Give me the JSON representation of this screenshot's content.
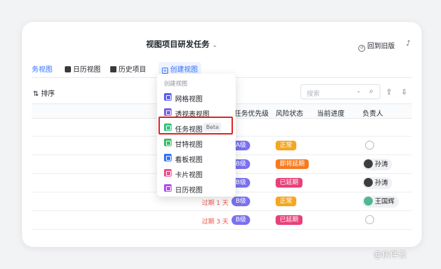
{
  "header": {
    "title": "视图项目研发任务",
    "title_chevron": "⌄",
    "back_label": "回到旧版"
  },
  "tabs": [
    {
      "label": "务视图",
      "active": true
    },
    {
      "label": "日历视图"
    },
    {
      "label": "历史项目"
    },
    {
      "label": "创建视图"
    }
  ],
  "toolbar": {
    "sort_label": "排序",
    "search_placeholder": "搜索"
  },
  "columns": [
    "任务优先级",
    "风险状态",
    "当前进度",
    "负责人"
  ],
  "rows": [
    {
      "overdue": "",
      "level": "A级",
      "risk": "正常",
      "risk_color": "#f5a623",
      "owner": ""
    },
    {
      "overdue": "",
      "level": "B级",
      "risk": "即将延期",
      "risk_color": "#f77a1e",
      "owner": "孙涛"
    },
    {
      "overdue": "",
      "level": "B级",
      "risk": "已延期",
      "risk_color": "#e8417a",
      "owner": "孙涛"
    },
    {
      "overdue": "过期 1 天",
      "level": "B级",
      "risk": "正常",
      "risk_color": "#f5a623",
      "owner": "王国辉"
    },
    {
      "overdue": "过期 3 天",
      "level": "B级",
      "risk": "已延期",
      "risk_color": "#e8417a",
      "owner": ""
    }
  ],
  "menu": {
    "header": "创建视图",
    "items": [
      {
        "label": "网格视图",
        "icon": "grid-icon",
        "color": "#5b5ff0"
      },
      {
        "label": "透视表视图",
        "icon": "pivot-icon",
        "color": "#7b61e0"
      },
      {
        "label": "任务视图",
        "icon": "task-icon",
        "color": "#34c47c",
        "badge": "Beta"
      },
      {
        "label": "甘特视图",
        "icon": "gantt-icon",
        "color": "#3eb96b"
      },
      {
        "label": "看板视图",
        "icon": "kanban-icon",
        "color": "#3370ff"
      },
      {
        "label": "卡片视图",
        "icon": "card-icon",
        "color": "#f0508a"
      },
      {
        "label": "日历视图",
        "icon": "calendar-icon",
        "color": "#b24ee8"
      }
    ]
  },
  "watermark": "@伙伴云"
}
